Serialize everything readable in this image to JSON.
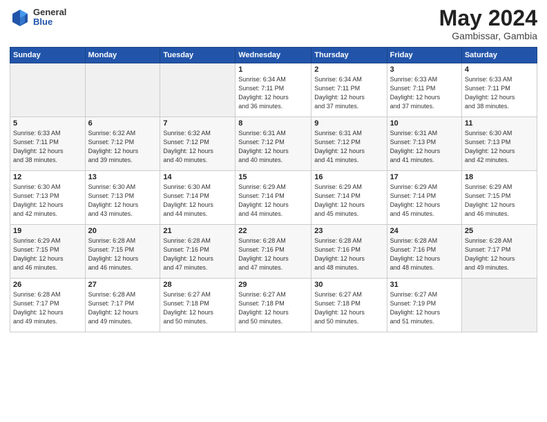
{
  "header": {
    "logo_general": "General",
    "logo_blue": "Blue",
    "month_year": "May 2024",
    "location": "Gambissar, Gambia"
  },
  "days_of_week": [
    "Sunday",
    "Monday",
    "Tuesday",
    "Wednesday",
    "Thursday",
    "Friday",
    "Saturday"
  ],
  "weeks": [
    [
      {
        "day": "",
        "info": ""
      },
      {
        "day": "",
        "info": ""
      },
      {
        "day": "",
        "info": ""
      },
      {
        "day": "1",
        "info": "Sunrise: 6:34 AM\nSunset: 7:11 PM\nDaylight: 12 hours\nand 36 minutes."
      },
      {
        "day": "2",
        "info": "Sunrise: 6:34 AM\nSunset: 7:11 PM\nDaylight: 12 hours\nand 37 minutes."
      },
      {
        "day": "3",
        "info": "Sunrise: 6:33 AM\nSunset: 7:11 PM\nDaylight: 12 hours\nand 37 minutes."
      },
      {
        "day": "4",
        "info": "Sunrise: 6:33 AM\nSunset: 7:11 PM\nDaylight: 12 hours\nand 38 minutes."
      }
    ],
    [
      {
        "day": "5",
        "info": "Sunrise: 6:33 AM\nSunset: 7:11 PM\nDaylight: 12 hours\nand 38 minutes."
      },
      {
        "day": "6",
        "info": "Sunrise: 6:32 AM\nSunset: 7:12 PM\nDaylight: 12 hours\nand 39 minutes."
      },
      {
        "day": "7",
        "info": "Sunrise: 6:32 AM\nSunset: 7:12 PM\nDaylight: 12 hours\nand 40 minutes."
      },
      {
        "day": "8",
        "info": "Sunrise: 6:31 AM\nSunset: 7:12 PM\nDaylight: 12 hours\nand 40 minutes."
      },
      {
        "day": "9",
        "info": "Sunrise: 6:31 AM\nSunset: 7:12 PM\nDaylight: 12 hours\nand 41 minutes."
      },
      {
        "day": "10",
        "info": "Sunrise: 6:31 AM\nSunset: 7:13 PM\nDaylight: 12 hours\nand 41 minutes."
      },
      {
        "day": "11",
        "info": "Sunrise: 6:30 AM\nSunset: 7:13 PM\nDaylight: 12 hours\nand 42 minutes."
      }
    ],
    [
      {
        "day": "12",
        "info": "Sunrise: 6:30 AM\nSunset: 7:13 PM\nDaylight: 12 hours\nand 42 minutes."
      },
      {
        "day": "13",
        "info": "Sunrise: 6:30 AM\nSunset: 7:13 PM\nDaylight: 12 hours\nand 43 minutes."
      },
      {
        "day": "14",
        "info": "Sunrise: 6:30 AM\nSunset: 7:14 PM\nDaylight: 12 hours\nand 44 minutes."
      },
      {
        "day": "15",
        "info": "Sunrise: 6:29 AM\nSunset: 7:14 PM\nDaylight: 12 hours\nand 44 minutes."
      },
      {
        "day": "16",
        "info": "Sunrise: 6:29 AM\nSunset: 7:14 PM\nDaylight: 12 hours\nand 45 minutes."
      },
      {
        "day": "17",
        "info": "Sunrise: 6:29 AM\nSunset: 7:14 PM\nDaylight: 12 hours\nand 45 minutes."
      },
      {
        "day": "18",
        "info": "Sunrise: 6:29 AM\nSunset: 7:15 PM\nDaylight: 12 hours\nand 46 minutes."
      }
    ],
    [
      {
        "day": "19",
        "info": "Sunrise: 6:29 AM\nSunset: 7:15 PM\nDaylight: 12 hours\nand 46 minutes."
      },
      {
        "day": "20",
        "info": "Sunrise: 6:28 AM\nSunset: 7:15 PM\nDaylight: 12 hours\nand 46 minutes."
      },
      {
        "day": "21",
        "info": "Sunrise: 6:28 AM\nSunset: 7:16 PM\nDaylight: 12 hours\nand 47 minutes."
      },
      {
        "day": "22",
        "info": "Sunrise: 6:28 AM\nSunset: 7:16 PM\nDaylight: 12 hours\nand 47 minutes."
      },
      {
        "day": "23",
        "info": "Sunrise: 6:28 AM\nSunset: 7:16 PM\nDaylight: 12 hours\nand 48 minutes."
      },
      {
        "day": "24",
        "info": "Sunrise: 6:28 AM\nSunset: 7:16 PM\nDaylight: 12 hours\nand 48 minutes."
      },
      {
        "day": "25",
        "info": "Sunrise: 6:28 AM\nSunset: 7:17 PM\nDaylight: 12 hours\nand 49 minutes."
      }
    ],
    [
      {
        "day": "26",
        "info": "Sunrise: 6:28 AM\nSunset: 7:17 PM\nDaylight: 12 hours\nand 49 minutes."
      },
      {
        "day": "27",
        "info": "Sunrise: 6:28 AM\nSunset: 7:17 PM\nDaylight: 12 hours\nand 49 minutes."
      },
      {
        "day": "28",
        "info": "Sunrise: 6:27 AM\nSunset: 7:18 PM\nDaylight: 12 hours\nand 50 minutes."
      },
      {
        "day": "29",
        "info": "Sunrise: 6:27 AM\nSunset: 7:18 PM\nDaylight: 12 hours\nand 50 minutes."
      },
      {
        "day": "30",
        "info": "Sunrise: 6:27 AM\nSunset: 7:18 PM\nDaylight: 12 hours\nand 50 minutes."
      },
      {
        "day": "31",
        "info": "Sunrise: 6:27 AM\nSunset: 7:19 PM\nDaylight: 12 hours\nand 51 minutes."
      },
      {
        "day": "",
        "info": ""
      }
    ]
  ]
}
